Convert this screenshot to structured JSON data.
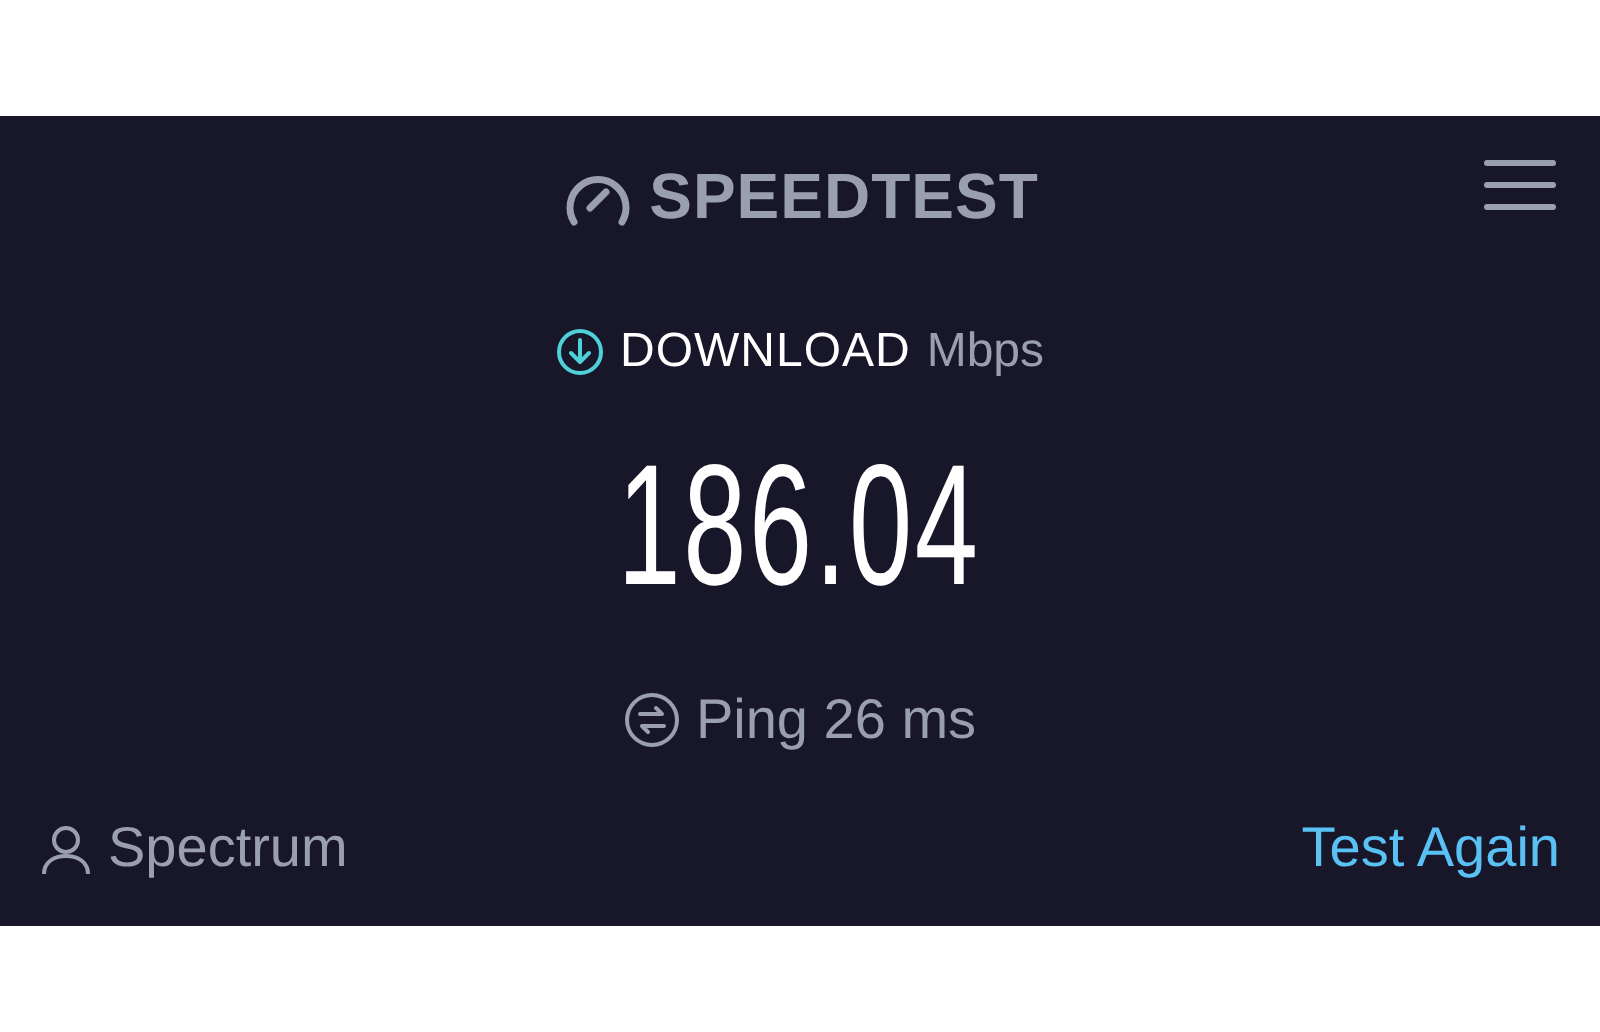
{
  "header": {
    "logo": "SPEEDTEST"
  },
  "result": {
    "label": "DOWNLOAD",
    "unit": "Mbps",
    "value": "186.04",
    "ping": "Ping 26 ms"
  },
  "footer": {
    "provider": "Spectrum",
    "action": "Test Again"
  }
}
